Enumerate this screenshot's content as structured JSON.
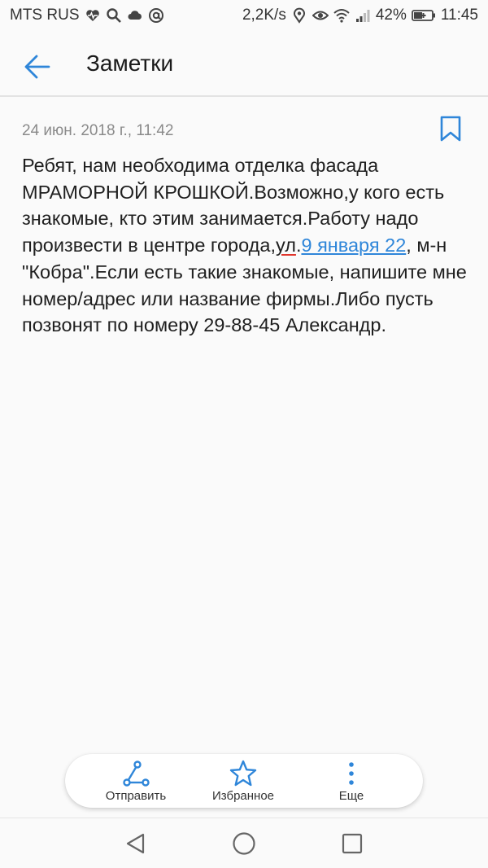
{
  "status_bar": {
    "carrier": "MTS RUS",
    "speed": "2,2K/s",
    "battery_percent": "42%",
    "time": "11:45",
    "icons": [
      "heart-rate-icon",
      "search-icon",
      "cloud-icon",
      "at-icon",
      "location-icon",
      "eye-icon",
      "wifi-icon",
      "signal-icon",
      "battery-icon"
    ]
  },
  "app_bar": {
    "title": "Заметки",
    "back_icon": "arrow-left-icon"
  },
  "note": {
    "date": "24 июн. 2018 г., 11:42",
    "bookmark_icon": "bookmark-icon",
    "body_part1": "Ребят, нам необходима отделка фасада МРАМОРНОЙ КРОШКОЙ.Возможно,у кого есть знакомые, кто этим занимается.Работу надо произвести в центре города,",
    "body_misspelled": "ул",
    "body_part2": ".",
    "body_link": "9 января 22",
    "body_part3": ", м-н \"Кобра\".Если есть такие знакомые, напишите мне номер/адрес или название фирмы.Либо пусть позвонят по номеру 29-88-45 Александр."
  },
  "actions": [
    {
      "label": "Отправить",
      "icon": "share-icon"
    },
    {
      "label": "Избранное",
      "icon": "star-icon"
    },
    {
      "label": "Еще",
      "icon": "more-vertical-icon"
    }
  ],
  "nav": {
    "back_icon": "triangle-back-icon",
    "home_icon": "circle-home-icon",
    "recent_icon": "square-recent-icon"
  },
  "colors": {
    "accent": "#2f86d9",
    "background": "#fafafa",
    "spell_error": "#e0342b"
  }
}
